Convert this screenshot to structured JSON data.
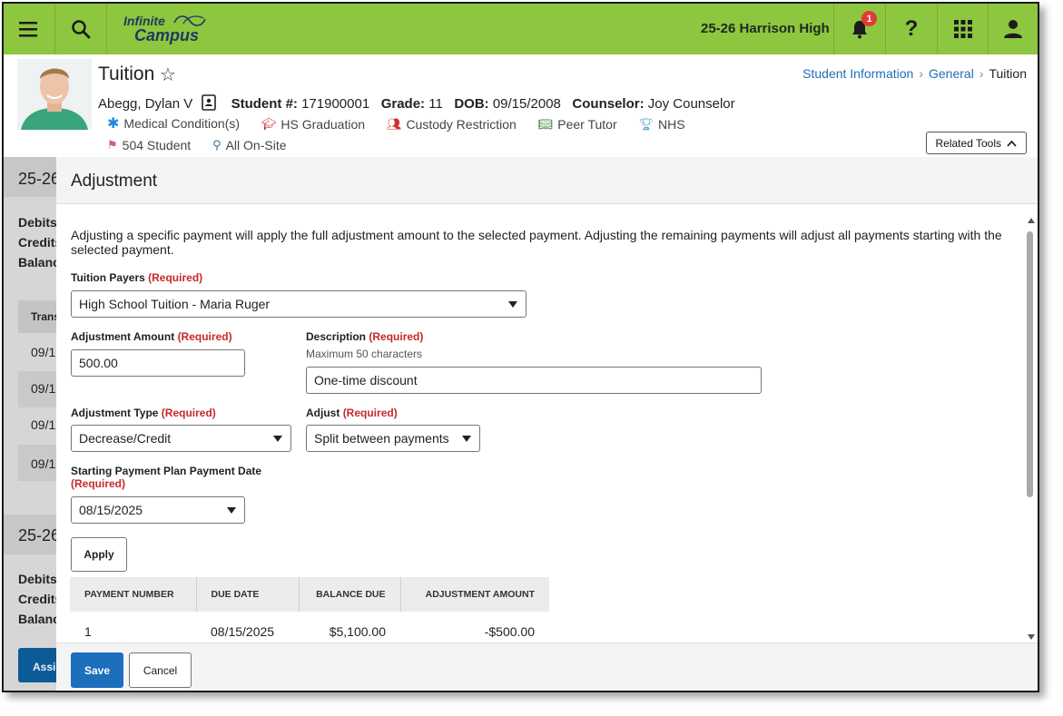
{
  "topbar": {
    "logo_line1": "Infinite",
    "logo_line2": "Campus",
    "school_year": "25-26 Harrison High",
    "notification_count": "1",
    "help_glyph": "?"
  },
  "header": {
    "title": "Tuition",
    "breadcrumb": [
      "Student Information",
      "General",
      "Tuition"
    ],
    "student_name": "Abegg, Dylan V",
    "student_number_label": "Student #:",
    "student_number": "171900001",
    "grade_label": "Grade:",
    "grade": "11",
    "dob_label": "DOB:",
    "dob": "09/15/2008",
    "counselor_label": "Counselor:",
    "counselor": "Joy Counselor",
    "flags_row1": [
      {
        "label": "Medical Condition(s)",
        "icon": "asterisk-icon",
        "color": "#1e88e5"
      },
      {
        "label": "HS Graduation",
        "icon": "graduation-cap-icon",
        "color": "#c62828"
      },
      {
        "label": "Custody Restriction",
        "icon": "people-icon",
        "color": "#d32f2f"
      },
      {
        "label": "Peer Tutor",
        "icon": "book-icon",
        "color": "#2e7d32"
      },
      {
        "label": "NHS",
        "icon": "trophy-icon",
        "color": "#5aa9c9"
      }
    ],
    "flags_row2": [
      {
        "label": "504 Student",
        "icon": "flag-icon",
        "color": "#c35ba8"
      },
      {
        "label": "All On-Site",
        "icon": "person-pin-icon",
        "color": "#3f6f8f"
      }
    ],
    "related_tools": "Related Tools"
  },
  "background": {
    "section1_title": "25-26",
    "section2_title": "25-26",
    "labels1": [
      "Debits",
      "Credits",
      "Balance"
    ],
    "labels2": [
      "Debits",
      "Credits",
      "Balance"
    ],
    "table_header": "Trans",
    "rows": [
      "09/1",
      "09/1",
      "09/1",
      "09/1"
    ],
    "button": "Assi"
  },
  "modal": {
    "title": "Adjustment",
    "intro": "Adjusting a specific payment will apply the full adjustment amount to the selected payment. Adjusting the remaining payments will adjust all payments starting with the selected payment.",
    "required": "(Required)",
    "tuition_payers": {
      "label": "Tuition Payers",
      "value": "High School Tuition - Maria Ruger"
    },
    "adjustment_amount": {
      "label": "Adjustment Amount",
      "value": "500.00"
    },
    "description": {
      "label": "Description",
      "hint": "Maximum 50 characters",
      "value": "One-time discount"
    },
    "adjustment_type": {
      "label": "Adjustment Type",
      "value": "Decrease/Credit"
    },
    "adjust": {
      "label": "Adjust",
      "value": "Split between payments"
    },
    "starting_date": {
      "label": "Starting Payment Plan Payment Date",
      "value": "08/15/2025"
    },
    "apply": "Apply",
    "table": {
      "headers": [
        "PAYMENT NUMBER",
        "DUE DATE",
        "BALANCE DUE",
        "ADJUSTMENT AMOUNT"
      ],
      "rows": [
        {
          "payment_number": "1",
          "due_date": "08/15/2025",
          "balance_due": "$5,100.00",
          "adjustment_amount": "-$500.00"
        }
      ]
    },
    "save": "Save",
    "cancel": "Cancel"
  },
  "colors": {
    "topbar": "#8dc63f",
    "primary_button": "#1b6fbd",
    "required": "#c62828",
    "link": "#1f6fb5"
  }
}
